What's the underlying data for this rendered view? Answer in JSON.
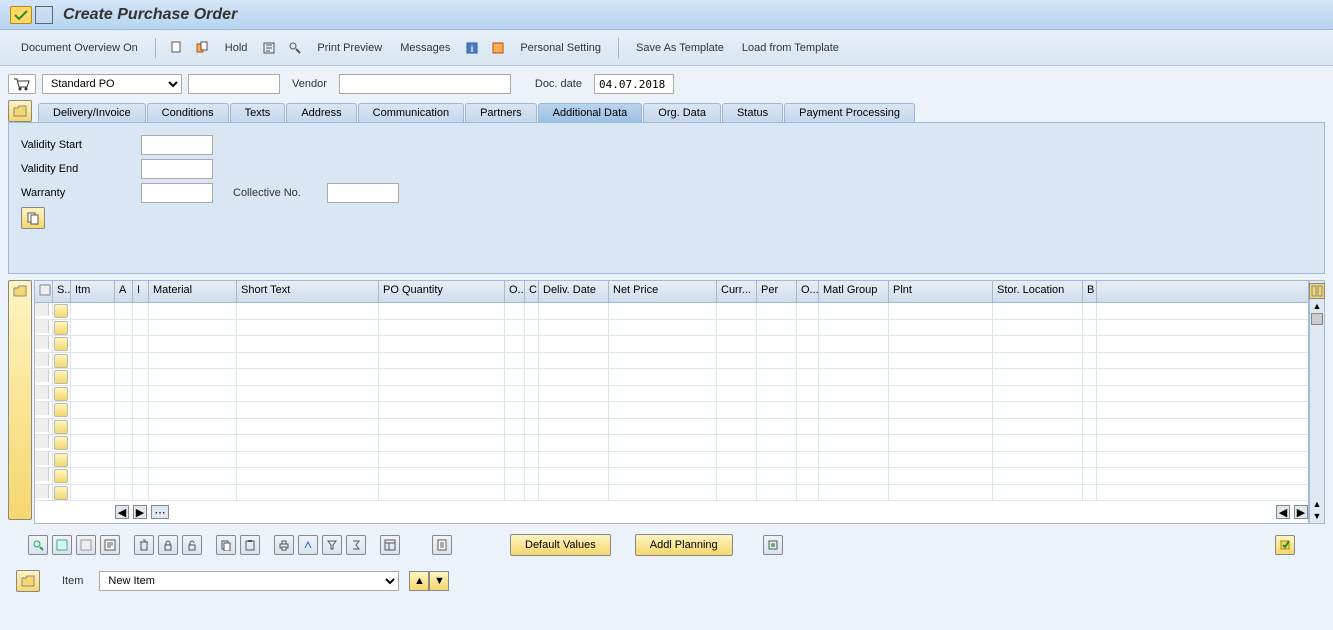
{
  "page_title": "Create Purchase Order",
  "toolbar": {
    "doc_overview": "Document Overview On",
    "hold": "Hold",
    "print_preview": "Print Preview",
    "messages": "Messages",
    "personal_setting": "Personal Setting",
    "save_template": "Save As Template",
    "load_template": "Load from Template"
  },
  "header": {
    "po_type": "Standard PO",
    "po_number": "",
    "vendor_label": "Vendor",
    "vendor_value": "",
    "doc_date_label": "Doc. date",
    "doc_date_value": "04.07.2018"
  },
  "tabs": [
    "Delivery/Invoice",
    "Conditions",
    "Texts",
    "Address",
    "Communication",
    "Partners",
    "Additional Data",
    "Org. Data",
    "Status",
    "Payment Processing"
  ],
  "active_tab_index": 6,
  "additional_data": {
    "validity_start_label": "Validity Start",
    "validity_start": "",
    "validity_end_label": "Validity End",
    "validity_end": "",
    "warranty_label": "Warranty",
    "warranty": "",
    "collective_no_label": "Collective No.",
    "collective_no": ""
  },
  "grid": {
    "columns": [
      "",
      "S..",
      "Itm",
      "A",
      "I",
      "Material",
      "Short Text",
      "PO Quantity",
      "O...",
      "C",
      "Deliv. Date",
      "Net Price",
      "Curr...",
      "Per",
      "O...",
      "Matl Group",
      "Plnt",
      "Stor. Location",
      "B"
    ],
    "row_count": 12
  },
  "bottom_buttons": {
    "default_values": "Default Values",
    "addl_planning": "Addl Planning"
  },
  "item_footer": {
    "item_label": "Item",
    "item_select": "New Item"
  }
}
